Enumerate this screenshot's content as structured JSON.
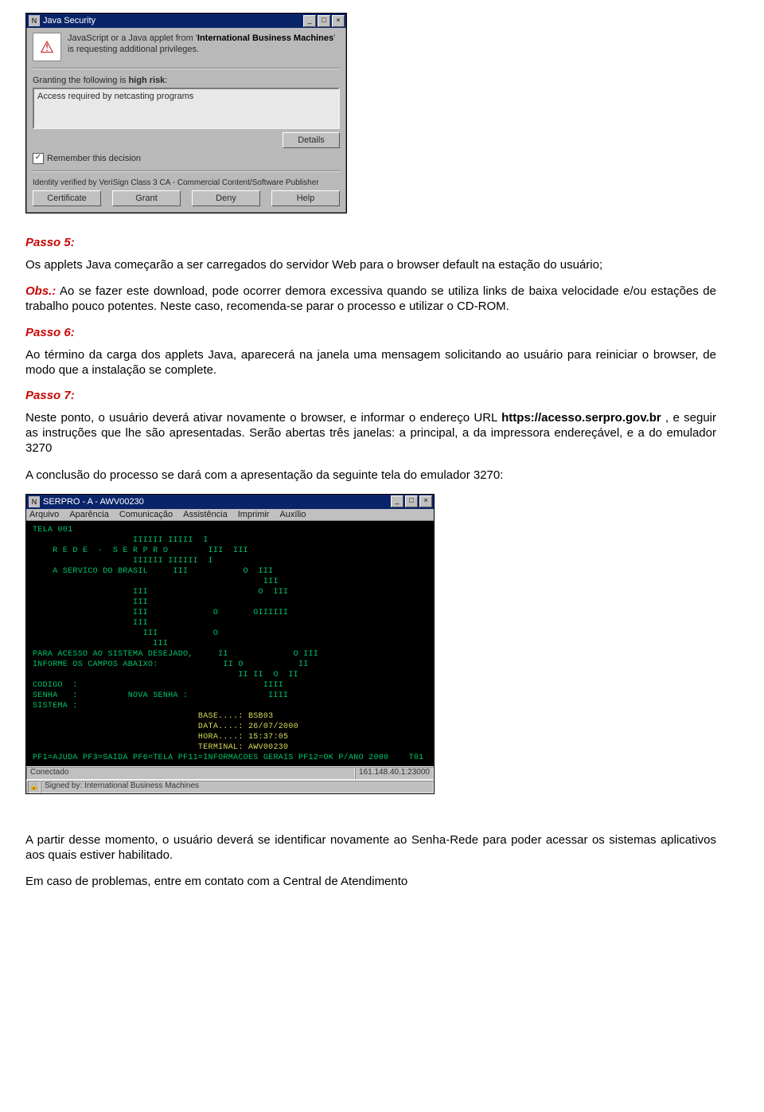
{
  "java_dialog": {
    "title": "Java Security",
    "win_min": "_",
    "win_max": "□",
    "win_close": "×",
    "msg_prefix": "JavaScript or a Java applet from '",
    "msg_bold": "International Business Machines",
    "msg_suffix": "' is requesting additional privileges.",
    "grant_prefix": "Granting the following is ",
    "grant_bold": "high risk",
    "grant_suffix": ":",
    "access_text": "Access required by netcasting programs",
    "details": "Details",
    "remember": "Remember this decision",
    "remember_check": "✓",
    "verified": "Identity verified by VeriSign Class 3 CA - Commercial Content/Software Publisher",
    "btn_certificate": "Certificate",
    "btn_grant": "Grant",
    "btn_deny": "Deny",
    "btn_help": "Help",
    "icon_glyph": "⚠"
  },
  "doc": {
    "passo5_h": "Passo 5:",
    "passo5_p": "Os applets Java começarão a ser carregados do servidor Web para o browser default na estação do usuário;",
    "obs_bold": "Obs.:",
    "obs_rest": " Ao se fazer este download, pode ocorrer demora excessiva quando se utiliza links de baixa velocidade e/ou estações de trabalho pouco potentes. Neste caso, recomenda-se parar o processo e utilizar o CD-ROM.",
    "passo6_h": "Passo 6:",
    "passo6_p": "Ao término da carga dos applets Java, aparecerá na janela uma mensagem solicitando ao usuário para reiniciar o browser, de modo que a instalação se complete.",
    "passo7_h": "Passo 7:",
    "passo7_a": "Neste ponto, o usuário deverá ativar novamente o browser, e informar o endereço URL ",
    "passo7_bold": "https://acesso.serpro.gov.br",
    "passo7_b": " , e seguir as instruções que lhe são apresentadas. Serão abertas três janelas: a principal, a da impressora endereçável, e a do emulador 3270",
    "conclusao": "A conclusão do processo se dará com a apresentação da seguinte tela do emulador 3270:",
    "final1": "A partir desse momento, o usuário deverá se identificar novamente ao Senha-Rede para poder acessar os sistemas aplicativos aos quais estiver habilitado.",
    "final2": "Em caso de problemas, entre em contato com a Central de Atendimento"
  },
  "terminal": {
    "title": "SERPRO - A - AWV00230",
    "win_min": "_",
    "win_max": "□",
    "win_close": "×",
    "menu": [
      "Arquivo",
      "Aparência",
      "Comunicação",
      "Assistência",
      "Imprimir",
      "Auxílio"
    ],
    "screen_text": "TELA 001\n                    IIIIII IIIII  I\n    R E D E  -  S E R P R O        III  III\n                    IIIIII IIIIII  I\n    A SERVICO DO BRASIL     III           O  III\n                                              III\n                    III                      O  III\n                    III\n                    III             O       OIIIIII\n                    III\n                      III           O\n                        III\nPARA ACESSO AO SISTEMA DESEJADO,     II             O III\nINFORME OS CAMPOS ABAIXO:             II O           II\n                                         II II  O  II\nCODIGO  :                                     IIII\nSENHA   :          NOVA SENHA :                IIII\nSISTEMA :\n",
    "yellow_text": "                                 BASE....: BSB03\n                                 DATA....: 26/07/2000\n                                 HORA....: 15:37:05\n                                 TERMINAL: AWV00230",
    "footer": "PF1=AJUDA PF3=SAIDA PF6=TELA PF11=INFORMACOES GERAIS PF12=OK P/ANO 2000    T01",
    "status_left": "Conectado",
    "status_right": "161.148.40.1:23000",
    "signed": "Signed by: International Business Machines",
    "lock": "🔒"
  }
}
